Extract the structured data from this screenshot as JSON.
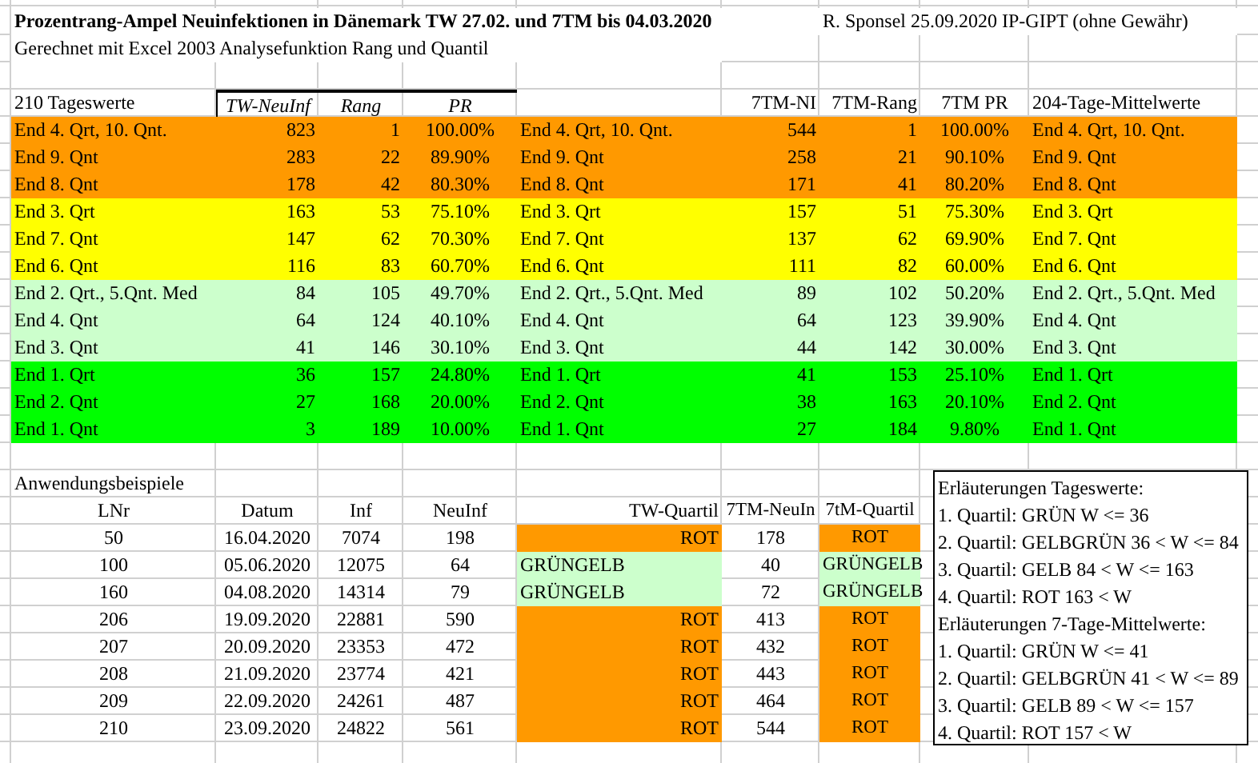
{
  "title": "Prozentrang-Ampel Neuinfektionen in Dänemark TW 27.02. und 7TM bis 04.03.2020",
  "author": "R. Sponsel 25.09.2020 IP-GIPT (ohne Gewähr)",
  "subtitle": "Gerechnet mit Excel 2003 Analysefunktion Rang und Quantil",
  "ranking_table": {
    "label": "210 Tageswerte",
    "columns": [
      "TW-NeuInf",
      "Rang",
      "PR",
      "7TM-NI",
      "7TM-Rang",
      "7TM PR",
      "204-Tage-Mittelwerte"
    ],
    "rows": [
      {
        "color": "#ff9900",
        "label": "End 4. Qrt, 10. Qnt.",
        "tw": "823",
        "rang": "1",
        "pr": "100.00%",
        "label_7tm": "End 4. Qrt, 10. Qnt.",
        "ni_7tm": "544",
        "rang_7tm": "1",
        "pr_7tm": "100.00%",
        "label_204": "End 4. Qrt, 10. Qnt."
      },
      {
        "color": "#ff9900",
        "label": "End 9. Qnt",
        "tw": "283",
        "rang": "22",
        "pr": "89.90%",
        "label_7tm": "End 9. Qnt",
        "ni_7tm": "258",
        "rang_7tm": "21",
        "pr_7tm": "90.10%",
        "label_204": "End 9. Qnt"
      },
      {
        "color": "#ff9900",
        "label": "End 8. Qnt",
        "tw": "178",
        "rang": "42",
        "pr": "80.30%",
        "label_7tm": "End 8. Qnt",
        "ni_7tm": "171",
        "rang_7tm": "41",
        "pr_7tm": "80.20%",
        "label_204": "End 8. Qnt"
      },
      {
        "color": "#ffff00",
        "label": "End 3. Qrt",
        "tw": "163",
        "rang": "53",
        "pr": "75.10%",
        "label_7tm": "End 3. Qrt",
        "ni_7tm": "157",
        "rang_7tm": "51",
        "pr_7tm": "75.30%",
        "label_204": "End 3. Qrt"
      },
      {
        "color": "#ffff00",
        "label": "End 7. Qnt",
        "tw": "147",
        "rang": "62",
        "pr": "70.30%",
        "label_7tm": "End 7. Qnt",
        "ni_7tm": "137",
        "rang_7tm": "62",
        "pr_7tm": "69.90%",
        "label_204": "End 7. Qnt"
      },
      {
        "color": "#ffff00",
        "label": "End 6. Qnt",
        "tw": "116",
        "rang": "83",
        "pr": "60.70%",
        "label_7tm": "End 6. Qnt",
        "ni_7tm": "111",
        "rang_7tm": "82",
        "pr_7tm": "60.00%",
        "label_204": "End 6. Qnt"
      },
      {
        "color": "#ccffcc",
        "label": "End 2. Qrt., 5.Qnt. Med",
        "tw": "84",
        "rang": "105",
        "pr": "49.70%",
        "label_7tm": "End 2. Qrt., 5.Qnt. Med",
        "ni_7tm": "89",
        "rang_7tm": "102",
        "pr_7tm": "50.20%",
        "label_204": "End 2. Qrt., 5.Qnt. Med"
      },
      {
        "color": "#ccffcc",
        "label": "End 4. Qnt",
        "tw": "64",
        "rang": "124",
        "pr": "40.10%",
        "label_7tm": "End 4. Qnt",
        "ni_7tm": "64",
        "rang_7tm": "123",
        "pr_7tm": "39.90%",
        "label_204": "End 4. Qnt"
      },
      {
        "color": "#ccffcc",
        "label": "End 3. Qnt",
        "tw": "41",
        "rang": "146",
        "pr": "30.10%",
        "label_7tm": "End 3. Qnt",
        "ni_7tm": "44",
        "rang_7tm": "142",
        "pr_7tm": "30.00%",
        "label_204": "End 3. Qnt"
      },
      {
        "color": "#00ff00",
        "label": "End 1. Qrt",
        "tw": "36",
        "rang": "157",
        "pr": "24.80%",
        "label_7tm": "End 1. Qrt",
        "ni_7tm": "41",
        "rang_7tm": "153",
        "pr_7tm": "25.10%",
        "label_204": "End 1. Qrt"
      },
      {
        "color": "#00ff00",
        "label": "End 2. Qnt",
        "tw": "27",
        "rang": "168",
        "pr": "20.00%",
        "label_7tm": "End 2. Qnt",
        "ni_7tm": "38",
        "rang_7tm": "163",
        "pr_7tm": "20.10%",
        "label_204": "End 2. Qnt"
      },
      {
        "color": "#00ff00",
        "label": "End 1. Qnt",
        "tw": "3",
        "rang": "189",
        "pr": "10.00%",
        "label_7tm": "End 1. Qnt",
        "ni_7tm": "27",
        "rang_7tm": "184",
        "pr_7tm": "9.80%",
        "label_204": "End 1. Qnt"
      }
    ]
  },
  "examples": {
    "title": "Anwendungsbeispiele",
    "columns": [
      "LNr",
      "Datum",
      "Inf",
      "NeuInf",
      "TW-Quartil",
      "7TM-NeuIn",
      "7tM-Quartil"
    ],
    "rows": [
      {
        "lnr": "50",
        "datum": "16.04.2020",
        "inf": "7074",
        "neuinf": "198",
        "tw_quartil": {
          "kind": "rot",
          "text": "ROT"
        },
        "neuinf_7tm": "178",
        "quartil_7tm": {
          "kind": "rot",
          "text": "ROT"
        }
      },
      {
        "lnr": "100",
        "datum": "05.06.2020",
        "inf": "12075",
        "neuinf": "64",
        "tw_quartil": {
          "kind": "gruengelb",
          "text": "GRÜNGELB"
        },
        "neuinf_7tm": "40",
        "quartil_7tm": {
          "kind": "gruengelb",
          "text": "GRÜNGELB"
        }
      },
      {
        "lnr": "160",
        "datum": "04.08.2020",
        "inf": "14314",
        "neuinf": "79",
        "tw_quartil": {
          "kind": "gruengelb",
          "text": "GRÜNGELB"
        },
        "neuinf_7tm": "72",
        "quartil_7tm": {
          "kind": "gruengelb",
          "text": "GRÜNGELB"
        }
      },
      {
        "lnr": "206",
        "datum": "19.09.2020",
        "inf": "22881",
        "neuinf": "590",
        "tw_quartil": {
          "kind": "rot",
          "text": "ROT"
        },
        "neuinf_7tm": "413",
        "quartil_7tm": {
          "kind": "rot",
          "text": "ROT"
        }
      },
      {
        "lnr": "207",
        "datum": "20.09.2020",
        "inf": "23353",
        "neuinf": "472",
        "tw_quartil": {
          "kind": "rot",
          "text": "ROT"
        },
        "neuinf_7tm": "432",
        "quartil_7tm": {
          "kind": "rot",
          "text": "ROT"
        }
      },
      {
        "lnr": "208",
        "datum": "21.09.2020",
        "inf": "23774",
        "neuinf": "421",
        "tw_quartil": {
          "kind": "rot",
          "text": "ROT"
        },
        "neuinf_7tm": "443",
        "quartil_7tm": {
          "kind": "rot",
          "text": "ROT"
        }
      },
      {
        "lnr": "209",
        "datum": "22.09.2020",
        "inf": "24261",
        "neuinf": "487",
        "tw_quartil": {
          "kind": "rot",
          "text": "ROT"
        },
        "neuinf_7tm": "464",
        "quartil_7tm": {
          "kind": "rot",
          "text": "ROT"
        }
      },
      {
        "lnr": "210",
        "datum": "23.09.2020",
        "inf": "24822",
        "neuinf": "561",
        "tw_quartil": {
          "kind": "rot",
          "text": "ROT"
        },
        "neuinf_7tm": "544",
        "quartil_7tm": {
          "kind": "rot",
          "text": "ROT"
        }
      }
    ]
  },
  "legend": [
    {
      "title": "Erläuterungen Tageswerte:",
      "lines": [
        "1. Quartil: GRÜN W <= 36",
        "2. Quartil: GELBGRÜN 36 < W <= 84",
        "3. Quartil: GELB 84 < W <= 163",
        "4. Quartil: ROT 163 < W"
      ]
    },
    {
      "title": "Erläuterungen 7-Tage-Mittelwerte:",
      "lines": [
        "1. Quartil: GRÜN W <= 41",
        "2. Quartil: GELBGRÜN 41 < W <= 89",
        "3. Quartil: GELB 89 < W <= 157",
        "4. Quartil: ROT 157 < W"
      ]
    }
  ]
}
